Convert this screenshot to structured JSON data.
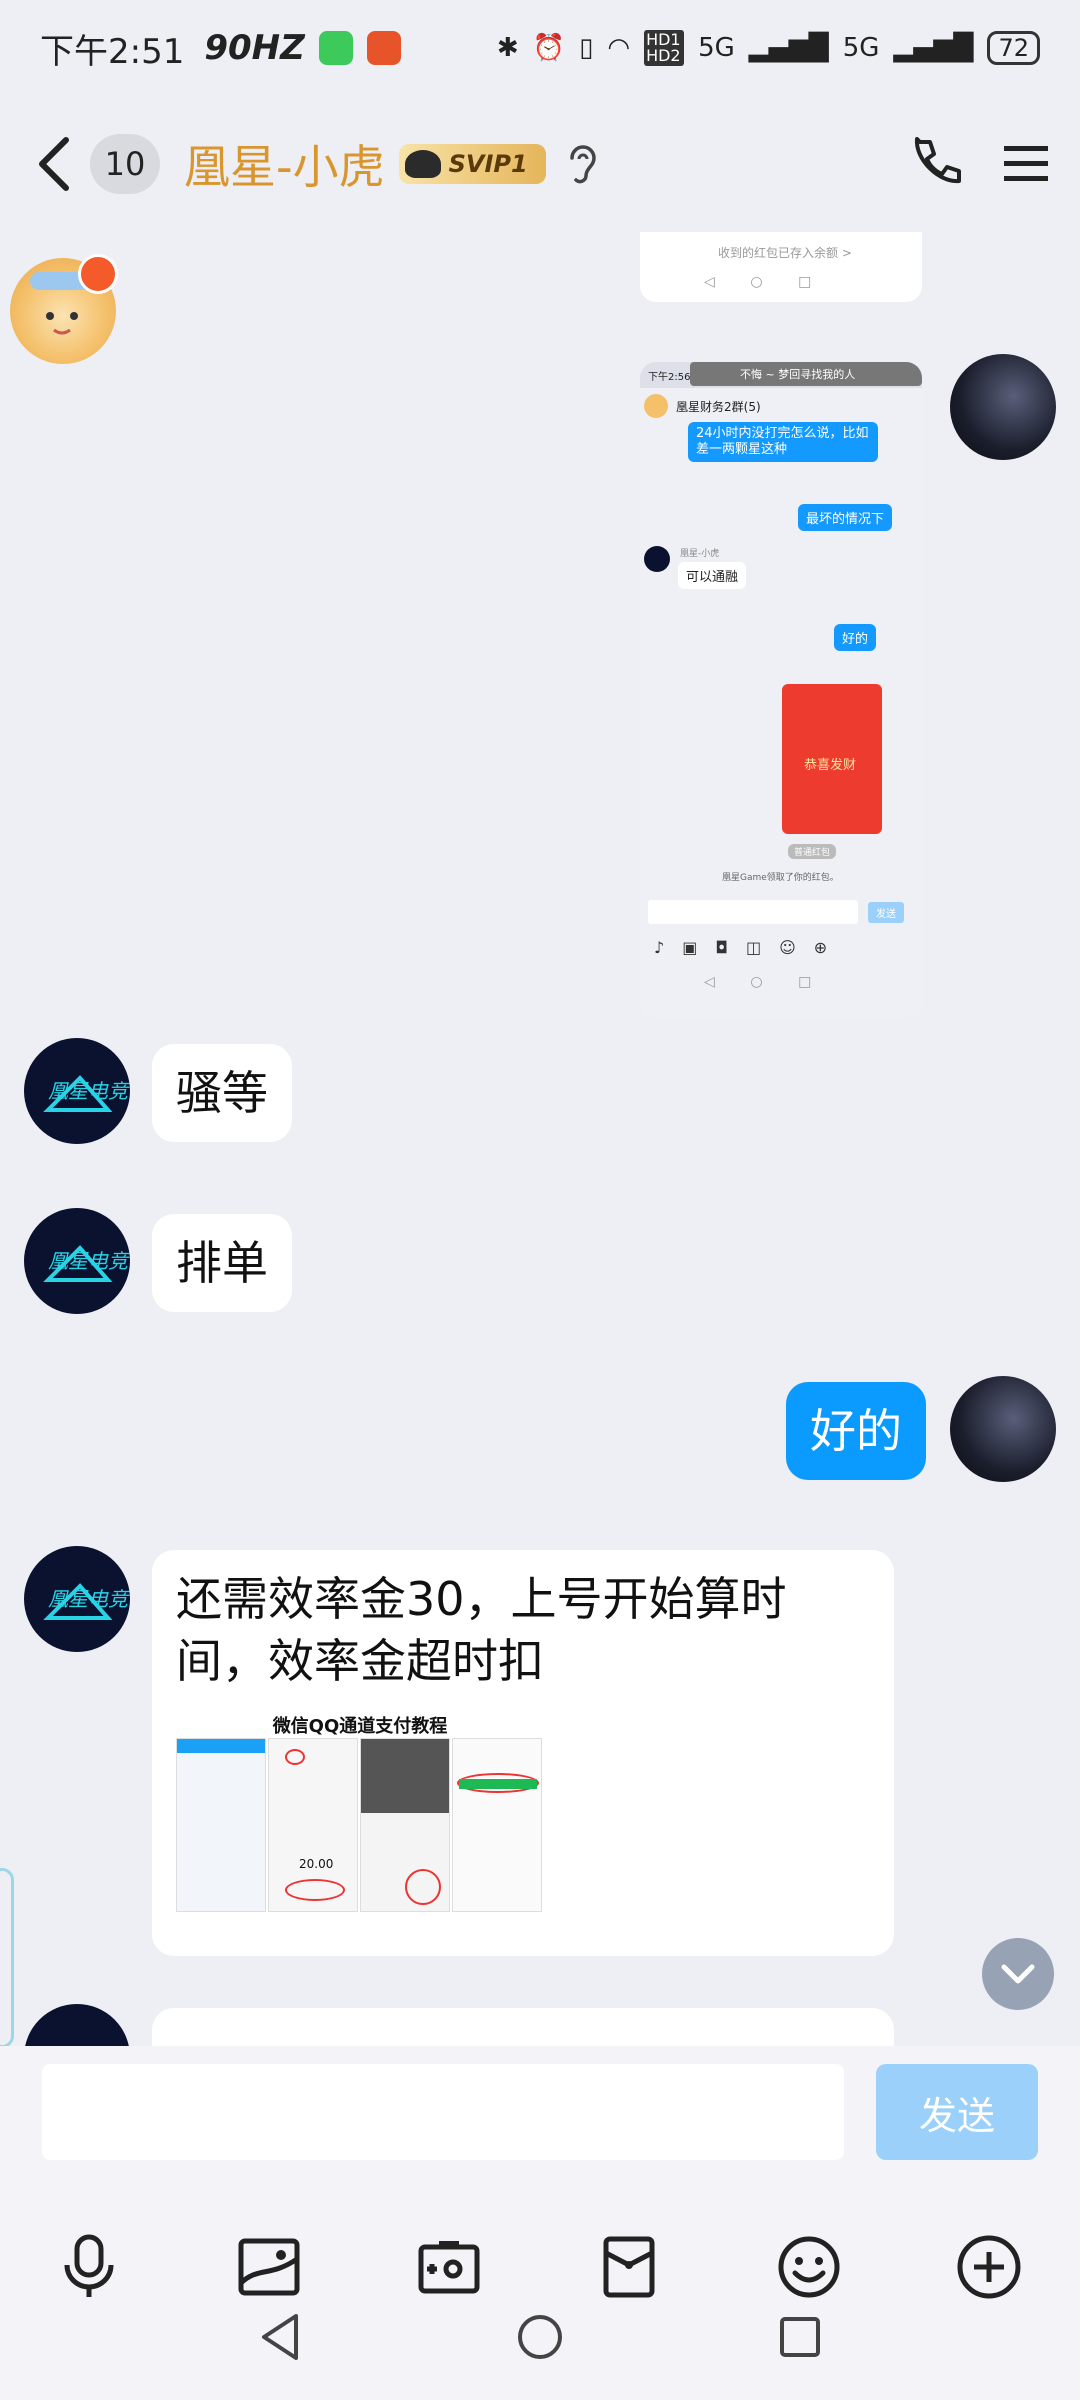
{
  "status_bar": {
    "time": "下午2:51",
    "refresh": "90HZ",
    "hd": "HD1 HD2",
    "net": "5G",
    "battery": "72"
  },
  "header": {
    "unread_count": "10",
    "title": "凰星-小虎",
    "badge": "SVIP1"
  },
  "screenshot_top": {
    "caption": "收到的红包已存入余额 >"
  },
  "screenshot_main": {
    "status_time": "下午2:56",
    "status_text": "不悔 ~ 梦回寻找我的人",
    "group_name": "凰星财务2群(5)",
    "messages": [
      "24小时内没打完怎么说，比如差一两颗星这种",
      "最坏的情况下",
      "可以通融",
      "好的",
      "恭喜发财",
      "凰星Game领取了你的红包。"
    ],
    "sender_label": "凰星-小虎",
    "send_label": "发送",
    "red_packet_footer": "普通红包"
  },
  "messages": [
    {
      "text": "骚等"
    },
    {
      "text": "排单"
    },
    {
      "text": "好的"
    },
    {
      "text": "还需效率金30，上号开始算时间，效率金超时扣"
    }
  ],
  "tutorial": {
    "title": "微信QQ通道支付教程",
    "amount": "20.00"
  },
  "input": {
    "placeholder": "",
    "send_label": "发送"
  },
  "icons": [
    "back-icon",
    "phone-icon",
    "menu-icon",
    "ear-icon",
    "mic-icon",
    "image-icon",
    "camera-icon",
    "red-packet-icon",
    "emoji-icon",
    "plus-icon",
    "chevron-down-icon",
    "nav-back-icon",
    "nav-home-icon",
    "nav-recent-icon"
  ],
  "colors": {
    "bubble_self": "#0B9BFF",
    "title": "#D9962F",
    "send_disabled": "#9AD0F9"
  }
}
